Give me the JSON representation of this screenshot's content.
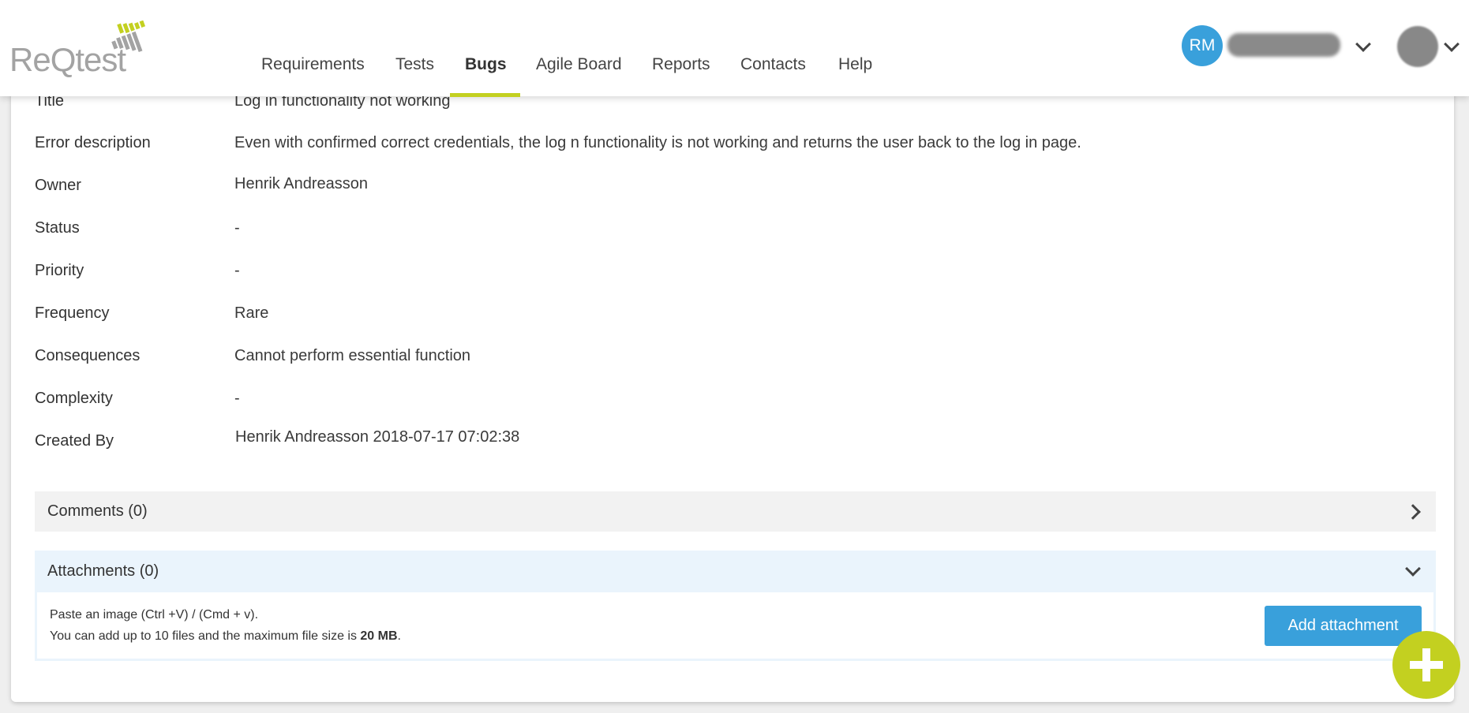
{
  "app": {
    "logo_text": "ReQtest"
  },
  "nav": {
    "items": [
      {
        "label": "Requirements",
        "active": false
      },
      {
        "label": "Tests",
        "active": false
      },
      {
        "label": "Bugs",
        "active": true
      },
      {
        "label": "Agile Board",
        "active": false
      },
      {
        "label": "Reports",
        "active": false
      },
      {
        "label": "Contacts",
        "active": false
      },
      {
        "label": "Help",
        "active": false
      }
    ]
  },
  "user": {
    "initials": "RM"
  },
  "fields": [
    {
      "label": "Title",
      "value": "Log in functionality not working"
    },
    {
      "label": "Error description",
      "value": "Even with confirmed correct credentials, the log n functionality is not working and returns the user back to the log in page."
    },
    {
      "label": "Owner",
      "value": "Henrik Andreasson"
    },
    {
      "label": "Status",
      "value": "-"
    },
    {
      "label": "Priority",
      "value": "-"
    },
    {
      "label": "Frequency",
      "value": "Rare"
    },
    {
      "label": "Consequences",
      "value": "Cannot perform essential function"
    },
    {
      "label": "Complexity",
      "value": "-"
    },
    {
      "label": "Created By",
      "value": "Henrik Andreasson 2018-07-17 07:02:38"
    }
  ],
  "comments": {
    "title": "Comments (0)"
  },
  "attachments": {
    "title": "Attachments (0)",
    "hint1": "Paste an image (Ctrl +V) / (Cmd + v).",
    "hint2_prefix": "You can add up to 10 files and the maximum file size is ",
    "hint2_bold": "20 MB",
    "hint2_suffix": ".",
    "button": "Add attachment"
  },
  "colors": {
    "accent": "#c3d020",
    "primary": "#39a0db"
  }
}
